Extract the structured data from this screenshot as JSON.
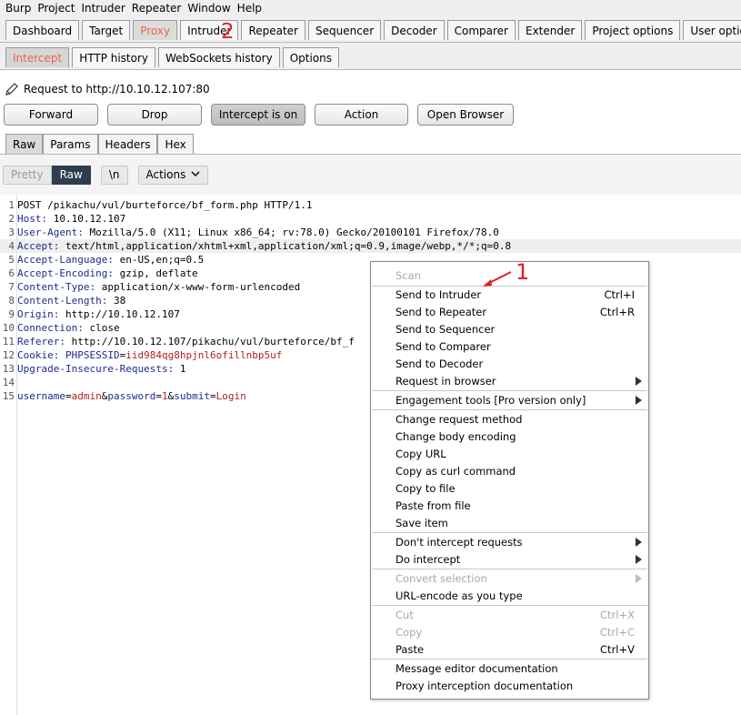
{
  "menubar": [
    "Burp",
    "Project",
    "Intruder",
    "Repeater",
    "Window",
    "Help"
  ],
  "main_tabs": [
    {
      "label": "Dashboard",
      "active": false
    },
    {
      "label": "Target",
      "active": false
    },
    {
      "label": "Proxy",
      "active": true
    },
    {
      "label": "Intruder",
      "active": false
    },
    {
      "label": "Repeater",
      "active": false
    },
    {
      "label": "Sequencer",
      "active": false
    },
    {
      "label": "Decoder",
      "active": false
    },
    {
      "label": "Comparer",
      "active": false
    },
    {
      "label": "Extender",
      "active": false
    },
    {
      "label": "Project options",
      "active": false
    },
    {
      "label": "User options",
      "active": false
    }
  ],
  "sub_tabs": [
    {
      "label": "Intercept",
      "active": true
    },
    {
      "label": "HTTP history",
      "active": false
    },
    {
      "label": "WebSockets history",
      "active": false
    },
    {
      "label": "Options",
      "active": false
    }
  ],
  "request_info": "Request to http://10.10.12.107:80",
  "buttons": {
    "forward": "Forward",
    "drop": "Drop",
    "intercept": "Intercept is on",
    "action": "Action",
    "open_browser": "Open Browser"
  },
  "view_tabs": [
    "Raw",
    "Params",
    "Headers",
    "Hex"
  ],
  "editor_toolbar": {
    "pretty": "Pretty",
    "raw": "Raw",
    "newline": "\\n",
    "actions": "Actions"
  },
  "request_lines": [
    {
      "num": "1",
      "name": "",
      "value": "POST /pikachu/vul/burteforce/bf_form.php HTTP/1.1"
    },
    {
      "num": "2",
      "name": "Host",
      "value": " 10.10.12.107"
    },
    {
      "num": "3",
      "name": "User-Agent",
      "value": " Mozilla/5.0 (X11; Linux x86_64; rv:78.0) Gecko/20100101 Firefox/78.0"
    },
    {
      "num": "4",
      "name": "Accept",
      "value": " text/html,application/xhtml+xml,application/xml;q=0.9,image/webp,*/*;q=0.8"
    },
    {
      "num": "5",
      "name": "Accept-Language",
      "value": " en-US,en;q=0.5"
    },
    {
      "num": "6",
      "name": "Accept-Encoding",
      "value": " gzip, deflate"
    },
    {
      "num": "7",
      "name": "Content-Type",
      "value": " application/x-www-form-urlencoded"
    },
    {
      "num": "8",
      "name": "Content-Length",
      "value": " 38"
    },
    {
      "num": "9",
      "name": "Origin",
      "value": " http://10.10.12.107"
    },
    {
      "num": "10",
      "name": "Connection",
      "value": " close"
    },
    {
      "num": "11",
      "name": "Referer",
      "value": " http://10.10.12.107/pikachu/vul/burteforce/bf_f"
    },
    {
      "num": "12",
      "name": "Cookie",
      "value": ""
    },
    {
      "num": "13",
      "name": "Upgrade-Insecure-Requests",
      "value": " 1"
    },
    {
      "num": "14",
      "name": "",
      "value": ""
    },
    {
      "num": "15",
      "name": "",
      "value": ""
    }
  ],
  "cookie": {
    "key": "PHPSESSID",
    "eq": "=",
    "value": "iid984qg8hpjnl6ofillnbp5uf"
  },
  "body_params": [
    {
      "key": "username",
      "value": "admin"
    },
    {
      "key": "password",
      "value": "1"
    },
    {
      "key": "submit",
      "value": "Login"
    }
  ],
  "context_menu": [
    {
      "label": "Scan",
      "shortcut": "",
      "disabled": true,
      "submenu": false
    },
    {
      "label": "Send to Intruder",
      "shortcut": "Ctrl+I",
      "disabled": false,
      "submenu": false
    },
    {
      "label": "Send to Repeater",
      "shortcut": "Ctrl+R",
      "disabled": false,
      "submenu": false
    },
    {
      "label": "Send to Sequencer",
      "shortcut": "",
      "disabled": false,
      "submenu": false
    },
    {
      "label": "Send to Comparer",
      "shortcut": "",
      "disabled": false,
      "submenu": false
    },
    {
      "label": "Send to Decoder",
      "shortcut": "",
      "disabled": false,
      "submenu": false
    },
    {
      "label": "Request in browser",
      "shortcut": "",
      "disabled": false,
      "submenu": true
    },
    {
      "label": "Engagement tools [Pro version only]",
      "shortcut": "",
      "disabled": false,
      "submenu": true
    },
    {
      "label": "Change request method",
      "shortcut": "",
      "disabled": false,
      "submenu": false
    },
    {
      "label": "Change body encoding",
      "shortcut": "",
      "disabled": false,
      "submenu": false
    },
    {
      "label": "Copy URL",
      "shortcut": "",
      "disabled": false,
      "submenu": false
    },
    {
      "label": "Copy as curl command",
      "shortcut": "",
      "disabled": false,
      "submenu": false
    },
    {
      "label": "Copy to file",
      "shortcut": "",
      "disabled": false,
      "submenu": false
    },
    {
      "label": "Paste from file",
      "shortcut": "",
      "disabled": false,
      "submenu": false
    },
    {
      "label": "Save item",
      "shortcut": "",
      "disabled": false,
      "submenu": false
    },
    {
      "label": "Don't intercept requests",
      "shortcut": "",
      "disabled": false,
      "submenu": true
    },
    {
      "label": "Do intercept",
      "shortcut": "",
      "disabled": false,
      "submenu": true
    },
    {
      "label": "Convert selection",
      "shortcut": "",
      "disabled": true,
      "submenu": true
    },
    {
      "label": "URL-encode as you type",
      "shortcut": "",
      "disabled": false,
      "submenu": false
    },
    {
      "label": "Cut",
      "shortcut": "Ctrl+X",
      "disabled": true,
      "submenu": false
    },
    {
      "label": "Copy",
      "shortcut": "Ctrl+C",
      "disabled": true,
      "submenu": false
    },
    {
      "label": "Paste",
      "shortcut": "Ctrl+V",
      "disabled": false,
      "submenu": false
    },
    {
      "label": "Message editor documentation",
      "shortcut": "",
      "disabled": false,
      "submenu": false
    },
    {
      "label": "Proxy interception documentation",
      "shortcut": "",
      "disabled": false,
      "submenu": false
    }
  ],
  "annotations": {
    "one": "1",
    "two": "2"
  },
  "colors": {
    "accent": "#e8664b",
    "annotation": "#e02020",
    "header_name": "#1f2b8f",
    "value_red": "#b32020"
  }
}
